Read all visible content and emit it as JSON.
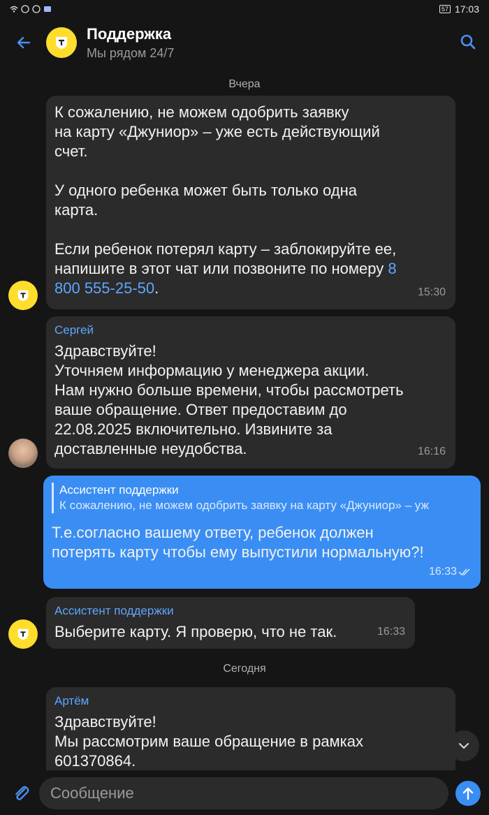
{
  "status": {
    "battery": "57",
    "time": "17:03"
  },
  "header": {
    "title": "Поддержка",
    "subtitle": "Мы рядом 24/7"
  },
  "dates": {
    "yesterday": "Вчера",
    "today": "Сегодня"
  },
  "messages": [
    {
      "text": "К сожалению, не можем одобрить заявку\nна карту «Джуниор» – уже есть действующий\nсчет.\n\nУ одного ребенка может быть только одна\nкарта.\n\nЕсли ребенок потерял карту – заблокируйте ее,\nнапишите в этот чат или позвоните по номеру ",
      "link": "8\n800 555-25-50",
      "text_after": ".",
      "time": "15:30"
    },
    {
      "sender": "Сергей",
      "text": "Здравствуйте!\nУточняем информацию у менеджера акции.\nНам нужно больше времени, чтобы рассмотреть\nваше обращение. Ответ предоставим до\n22.08.2025 включительно. Извините за\nдоставленные неудобства.",
      "time": "16:16"
    },
    {
      "reply_name": "Ассистент поддержки",
      "reply_text": "К сожалению, не можем одобрить заявку на карту «Джуниор» – уж",
      "text": "Т.е.согласно вашему ответу, ребенок должен\nпотерять карту чтобы ему выпустили нормальную?!",
      "time": "16:33"
    },
    {
      "sender": "Ассистент поддержки",
      "text": "Выберите карту. Я проверю, что не так.",
      "time": "16:33"
    },
    {
      "sender": "Артём",
      "text": "Здравствуйте!\nМы рассмотрим ваше обращение в рамках\n601370864."
    }
  ],
  "composer": {
    "placeholder": "Сообщение"
  },
  "colors": {
    "accent": "#3a8ef3",
    "brand": "#ffdd2d",
    "background": "#151515",
    "bubble": "#2b2b2b",
    "link": "#5ea6ff"
  }
}
